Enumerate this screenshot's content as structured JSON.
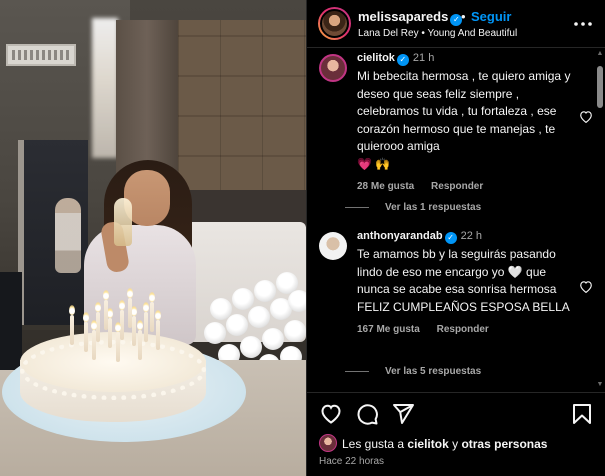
{
  "post": {
    "username": "melissapareds",
    "separator": "•",
    "follow_label": "Seguir",
    "music": "Lana Del Rey • Young And Beautiful",
    "more_icon": "more-horizontal-icon"
  },
  "comments": [
    {
      "username": "cielitok",
      "verified": true,
      "time": "21 h",
      "text": "Mi bebecita hermosa , te quiero amiga y deseo que seas feliz siempre , celebramos tu vida , tu fortaleza , ese corazón hermoso que te manejas , te quierooo amiga",
      "emoji": "💗 🙌",
      "likes": "28 Me gusta",
      "reply_label": "Responder",
      "view_replies": "Ver las 1 respuestas"
    },
    {
      "username": "anthonyarandab",
      "verified": true,
      "time": "22 h",
      "text": "Te amamos bb y la seguirás pasando lindo de eso me encargo yo 🤍 que nunca se acabe esa sonrisa hermosa FELIZ CUMPLEAÑOS ESPOSA BELLA",
      "likes": "167 Me gusta",
      "reply_label": "Responder",
      "view_replies": "Ver las 5 respuestas"
    }
  ],
  "likes_summary": {
    "prefix": "Les gusta a",
    "user": "cielitok",
    "conjunction": "y",
    "others": "otras personas"
  },
  "time_ago": "Hace 22 horas",
  "icons": [
    "heart-icon",
    "comment-icon",
    "share-icon",
    "bookmark-icon"
  ],
  "colors": {
    "accent": "#0095f6",
    "background": "#000000",
    "muted": "#a8a8a8"
  }
}
